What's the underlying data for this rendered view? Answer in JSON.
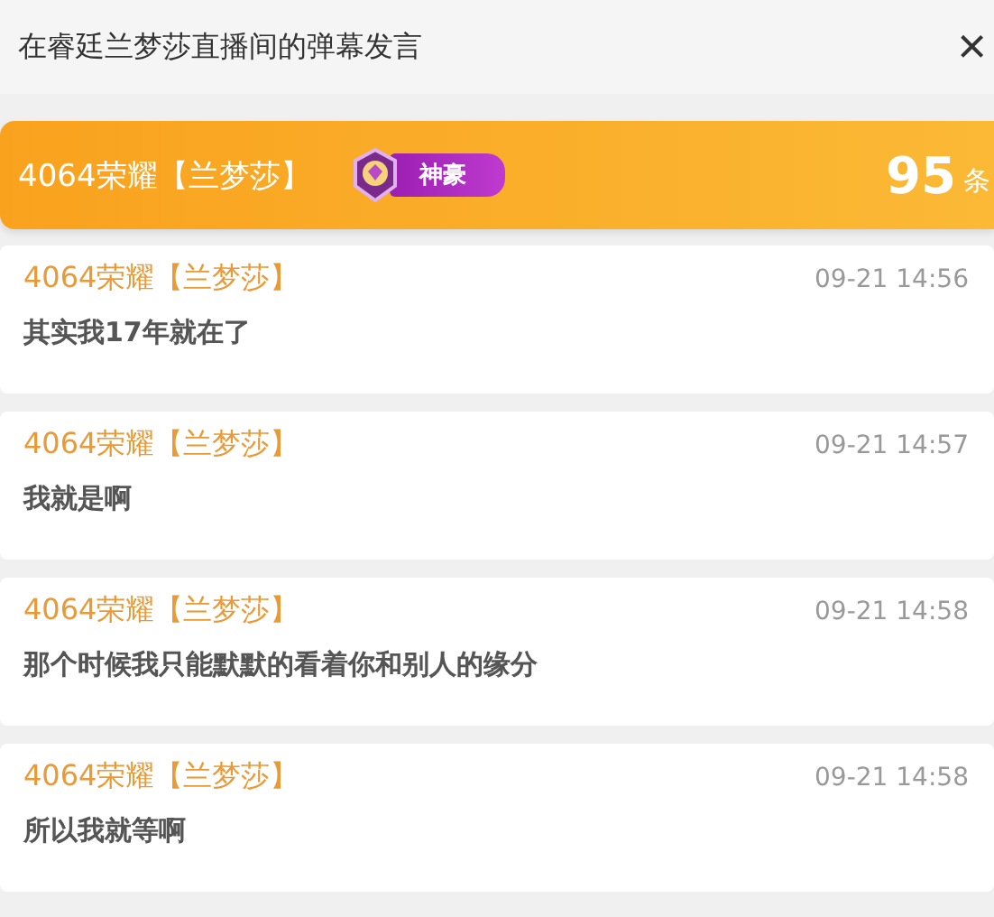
{
  "header": {
    "title": "在睿廷兰梦莎直播间的弹幕发言",
    "close": "×"
  },
  "banner": {
    "user": "4064荣耀【兰梦莎】",
    "badge": "神豪",
    "count": "95",
    "count_unit": "条"
  },
  "messages": [
    {
      "user": "4064荣耀【兰梦莎】",
      "time": "09-21 14:56",
      "text": "其实我17年就在了"
    },
    {
      "user": "4064荣耀【兰梦莎】",
      "time": "09-21 14:57",
      "text": "我就是啊"
    },
    {
      "user": "4064荣耀【兰梦莎】",
      "time": "09-21 14:58",
      "text": "那个时候我只能默默的看着你和别人的缘分"
    },
    {
      "user": "4064荣耀【兰梦莎】",
      "time": "09-21 14:58",
      "text": "所以我就等啊"
    }
  ]
}
